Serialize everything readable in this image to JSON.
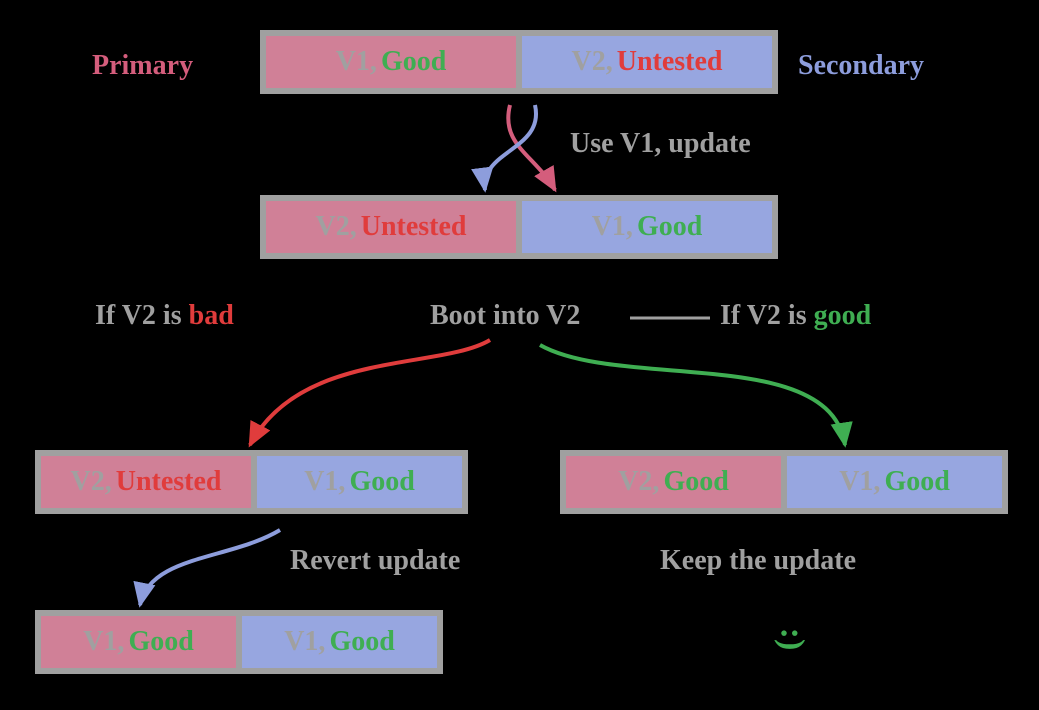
{
  "labels": {
    "primary": "Primary",
    "secondary": "Secondary",
    "use_v1_update": "Use V1, update",
    "boot_into_v2": "Boot into V2",
    "if_v2_bad_prefix": "If V2 is ",
    "if_v2_bad_word": "bad",
    "if_v2_good_prefix": "If V2 is ",
    "if_v2_good_word": "good",
    "revert_update": "Revert update",
    "keep_the_update": "Keep the update",
    "smile": ":)"
  },
  "boxes": {
    "row1": {
      "left": {
        "v": "V1,",
        "s": "Good"
      },
      "right": {
        "v": "V2,",
        "s": "Untested"
      }
    },
    "row2": {
      "left": {
        "v": "V2,",
        "s": "Untested"
      },
      "right": {
        "v": "V1,",
        "s": "Good"
      }
    },
    "row3left": {
      "left": {
        "v": "V2,",
        "s": "Untested"
      },
      "right": {
        "v": "V1,",
        "s": "Good"
      }
    },
    "row3right": {
      "left": {
        "v": "V2,",
        "s": "Good"
      },
      "right": {
        "v": "V1,",
        "s": "Good"
      }
    },
    "row4": {
      "left": {
        "v": "V1,",
        "s": "Good"
      },
      "right": {
        "v": "V1,",
        "s": "Good"
      }
    }
  }
}
